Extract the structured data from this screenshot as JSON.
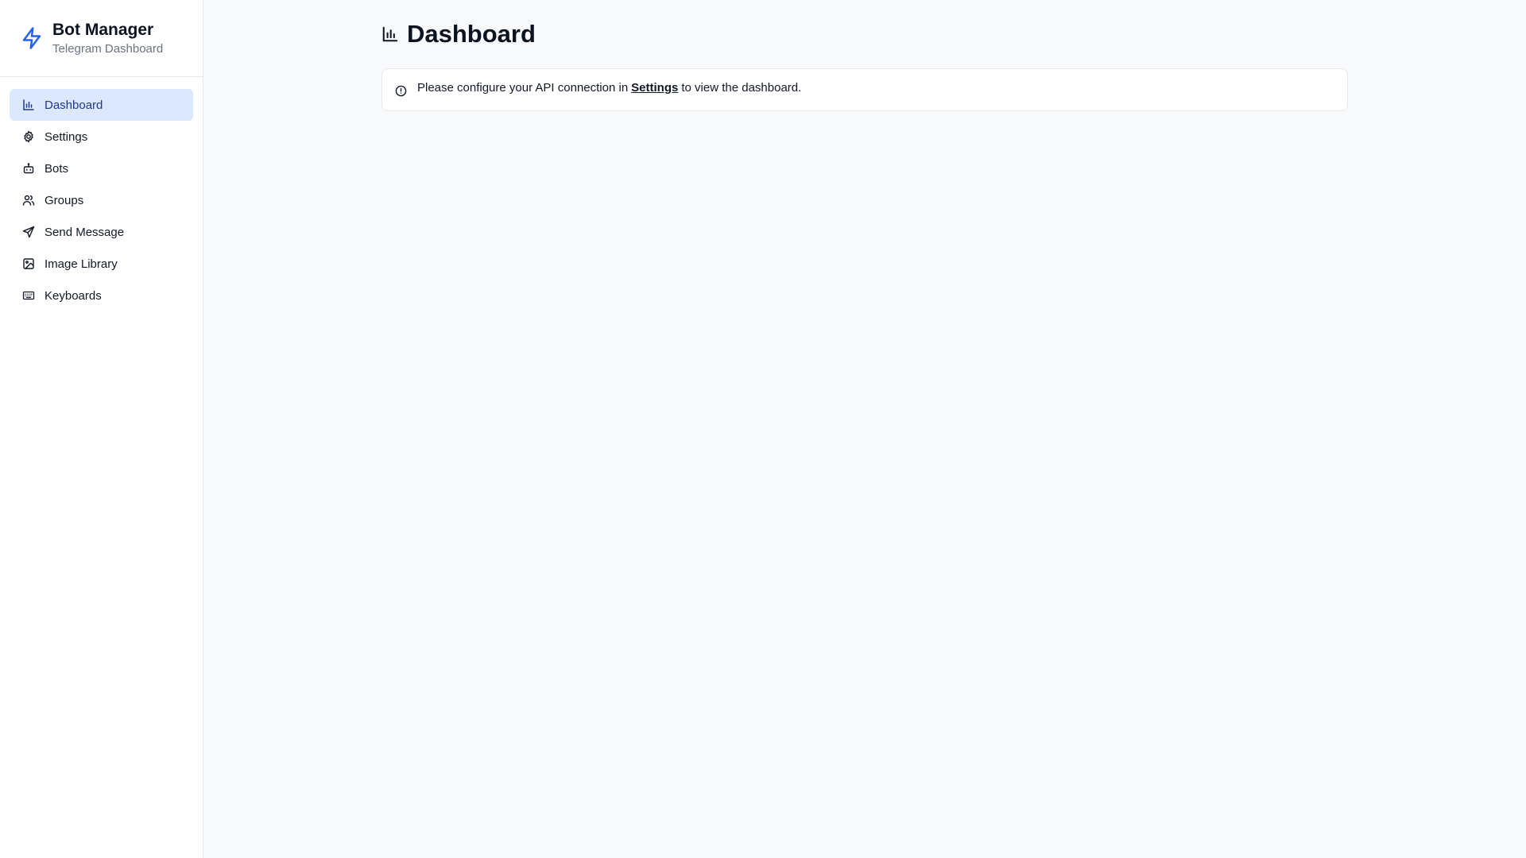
{
  "brand": {
    "title": "Bot Manager",
    "subtitle": "Telegram Dashboard",
    "icon": "lightning-bolt-icon",
    "accent_color": "#2563eb"
  },
  "sidebar": {
    "items": [
      {
        "label": "Dashboard",
        "icon": "bar-chart-icon",
        "active": true
      },
      {
        "label": "Settings",
        "icon": "gear-icon",
        "active": false
      },
      {
        "label": "Bots",
        "icon": "bot-icon",
        "active": false
      },
      {
        "label": "Groups",
        "icon": "users-icon",
        "active": false
      },
      {
        "label": "Send Message",
        "icon": "send-icon",
        "active": false
      },
      {
        "label": "Image Library",
        "icon": "image-icon",
        "active": false
      },
      {
        "label": "Keyboards",
        "icon": "keyboard-icon",
        "active": false
      }
    ]
  },
  "main": {
    "title": "Dashboard",
    "title_icon": "bar-chart-icon",
    "alert": {
      "icon": "info-circle-icon",
      "text_before": "Please configure your API connection in",
      "link_label": "Settings",
      "text_after": "to view the dashboard."
    }
  },
  "colors": {
    "active_nav_bg": "#dbe8fd",
    "page_bg": "#f8f9fb"
  }
}
